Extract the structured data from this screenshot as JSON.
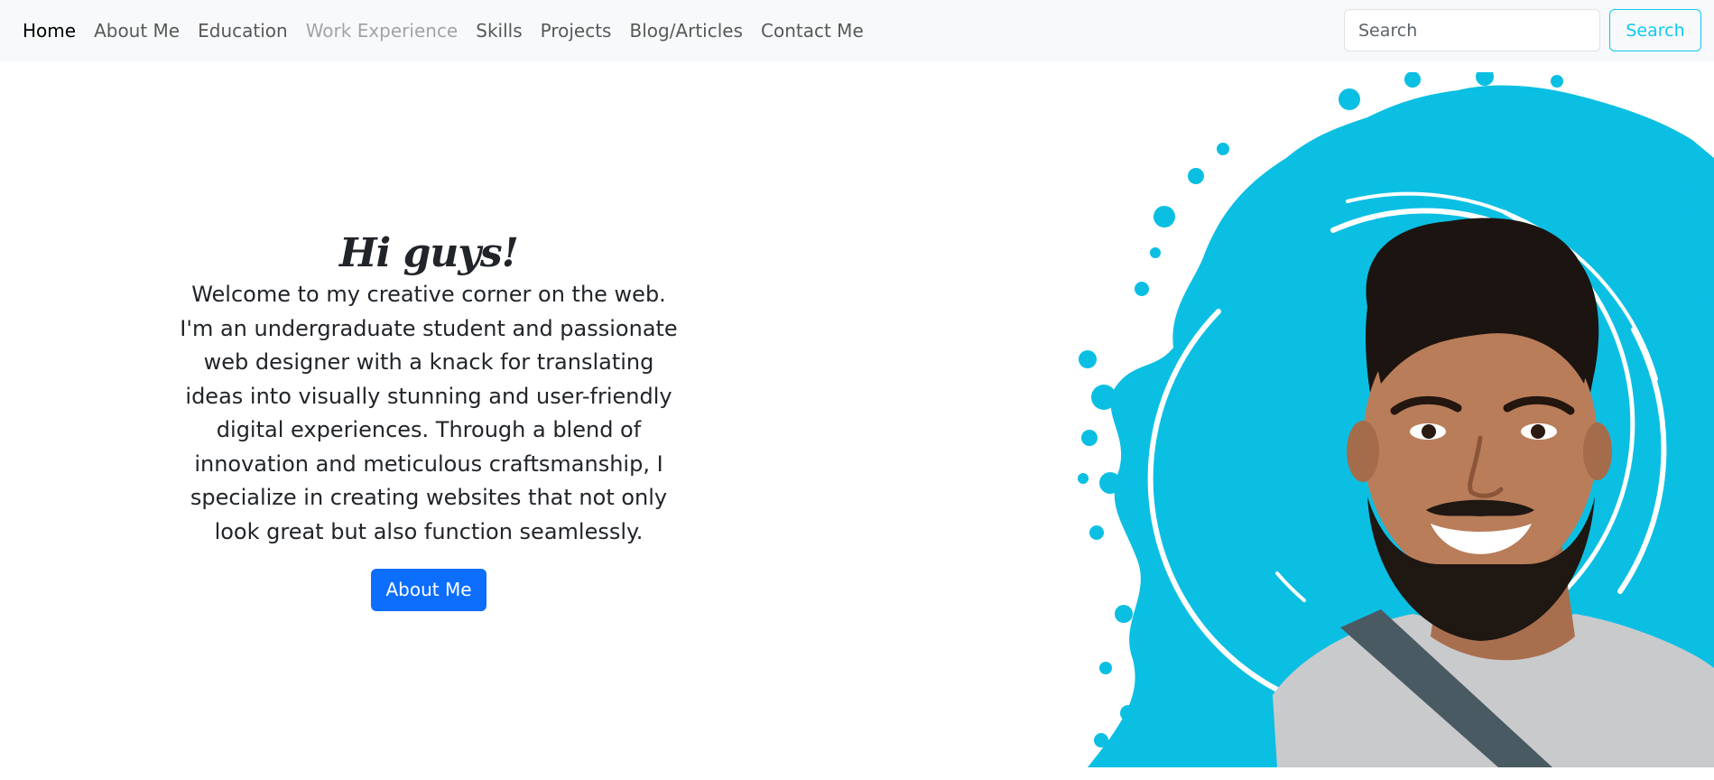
{
  "nav": {
    "items": [
      {
        "label": "Home",
        "state": "active"
      },
      {
        "label": "About Me",
        "state": "normal"
      },
      {
        "label": "Education",
        "state": "normal"
      },
      {
        "label": "Work Experience",
        "state": "disabled"
      },
      {
        "label": "Skills",
        "state": "normal"
      },
      {
        "label": "Projects",
        "state": "normal"
      },
      {
        "label": "Blog/Articles",
        "state": "normal"
      },
      {
        "label": "Contact Me",
        "state": "normal"
      }
    ],
    "search": {
      "placeholder": "Search",
      "value": "",
      "button_label": "Search"
    }
  },
  "hero": {
    "title": "Hi guys!",
    "paragraph": "Welcome to my creative corner on the web. I'm an undergraduate student and passionate web designer with a knack for translating ideas into visually stunning and user-friendly digital experiences. Through a blend of innovation and meticulous craftsmanship, I specialize in creating websites that not only look great but also function seamlessly.",
    "button_label": "About Me"
  },
  "colors": {
    "accent": "#0dcaf0",
    "splash": "#0bbfe3",
    "primary_button": "#0d6efd",
    "navbar_bg": "#f8f9fa"
  },
  "illustration": {
    "icon": "portrait-photo"
  }
}
